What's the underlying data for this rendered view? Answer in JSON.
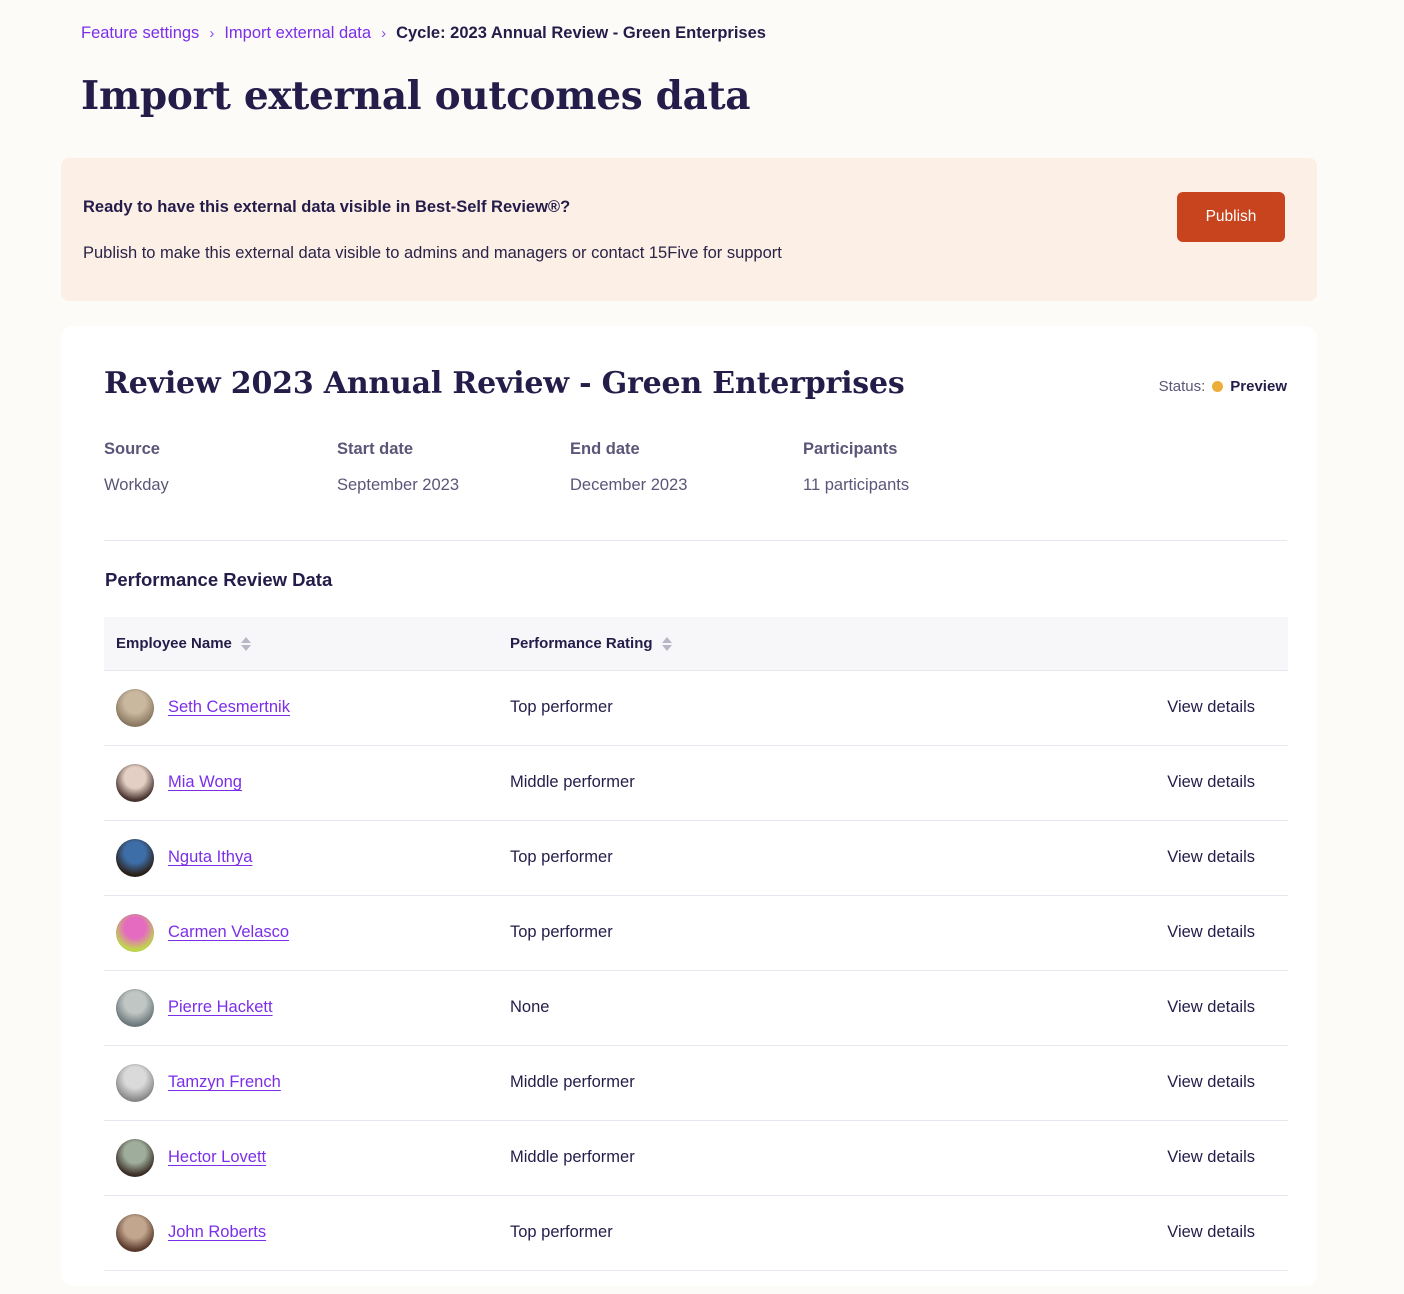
{
  "breadcrumb": {
    "items": [
      {
        "label": "Feature settings",
        "current": false
      },
      {
        "label": "Import external data",
        "current": false
      },
      {
        "label": "Cycle: 2023 Annual Review - Green Enterprises",
        "current": true
      }
    ],
    "separator": "›"
  },
  "page": {
    "title": "Import external outcomes data"
  },
  "banner": {
    "title": "Ready to have this external data visible in Best-Self Review®?",
    "subtitle": "Publish to make this external data visible to admins and managers or contact 15Five for support",
    "publish_label": "Publish",
    "background_color": "#FBEFE6",
    "button_color": "#C8441E"
  },
  "card": {
    "title": "Review 2023 Annual Review - Green Enterprises",
    "status": {
      "label": "Status:",
      "value": "Preview",
      "dot_color": "#EDAE39"
    },
    "meta": [
      {
        "label": "Source",
        "value": "Workday"
      },
      {
        "label": "Start date",
        "value": "September 2023"
      },
      {
        "label": "End date",
        "value": "December 2023"
      },
      {
        "label": "Participants",
        "value": "11 participants"
      }
    ],
    "table": {
      "section_title": "Performance Review Data",
      "columns": [
        {
          "label": "Employee Name",
          "sortable": true
        },
        {
          "label": "Performance Rating",
          "sortable": true
        },
        {
          "label": "",
          "sortable": false
        }
      ],
      "action_label": "View details",
      "rows": [
        {
          "name": "Seth Cesmertnik",
          "rating": "Top performer",
          "avatar_colors": [
            "#C9B79E",
            "#8C7A63"
          ]
        },
        {
          "name": "Mia Wong",
          "rating": "Middle performer",
          "avatar_colors": [
            "#E3CFC4",
            "#4A3430"
          ]
        },
        {
          "name": "Nguta Ithya",
          "rating": "Top performer",
          "avatar_colors": [
            "#3E6EA8",
            "#2B2019"
          ]
        },
        {
          "name": "Carmen Velasco",
          "rating": "Top performer",
          "avatar_colors": [
            "#E46BC0",
            "#C0D94A"
          ]
        },
        {
          "name": "Pierre Hackett",
          "rating": "None",
          "avatar_colors": [
            "#BFC6C4",
            "#6E7A7D"
          ]
        },
        {
          "name": "Tamzyn French",
          "rating": "Middle performer",
          "avatar_colors": [
            "#DADADA",
            "#8A8A8A"
          ]
        },
        {
          "name": "Hector Lovett",
          "rating": "Middle performer",
          "avatar_colors": [
            "#9FAE9C",
            "#3B2E27"
          ]
        },
        {
          "name": "John Roberts",
          "rating": "Top performer",
          "avatar_colors": [
            "#C2A68E",
            "#5A3A2C"
          ]
        }
      ]
    }
  },
  "theme": {
    "page_background": "#FCFBF8",
    "link_purple": "#7B2EE8",
    "ink_navy": "#241C49"
  }
}
